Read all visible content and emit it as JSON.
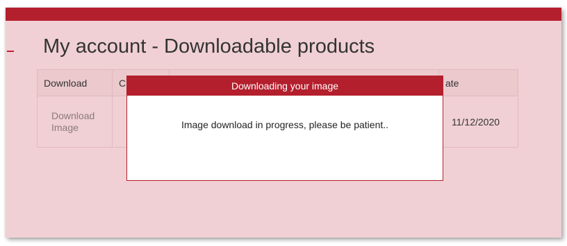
{
  "colors": {
    "brand": "#b41f2d",
    "background": "#f0d0d4",
    "table_header": "#ebc9cd",
    "link": "#8a7a7c"
  },
  "page": {
    "title": "My account - Downloadable products"
  },
  "table": {
    "headers": [
      "Download",
      "C",
      "",
      "ate"
    ],
    "rows": [
      {
        "download_link": "Download Image",
        "c": "",
        "mid": "",
        "date": "11/12/2020"
      }
    ]
  },
  "modal": {
    "title": "Downloading your image",
    "message": "Image download in progress, please be patient.."
  }
}
